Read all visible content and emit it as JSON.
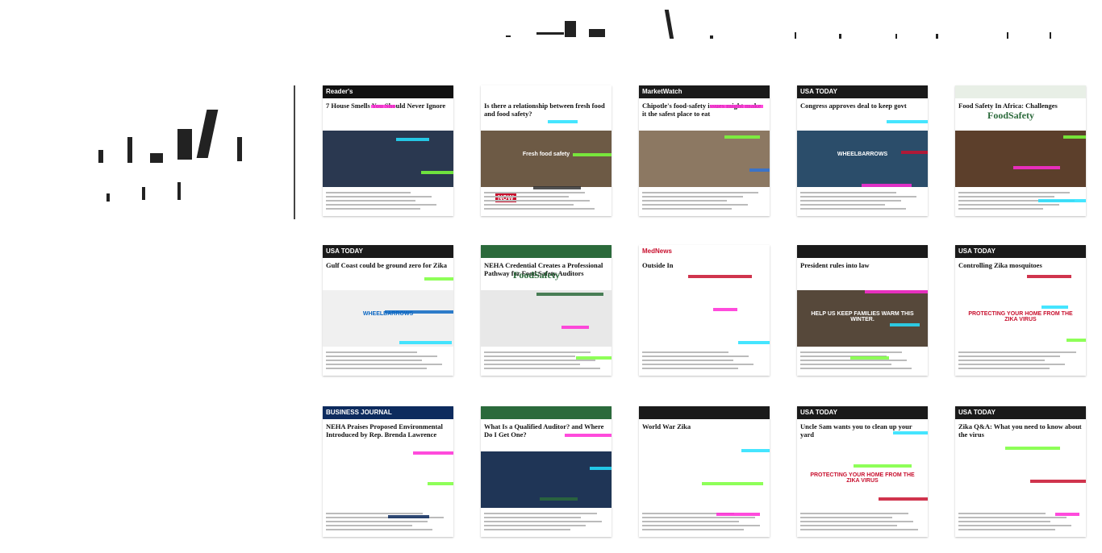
{
  "tiles": [
    {
      "id": "readers-digest",
      "logo": "Reader's",
      "title": "7 House Smells You Should Never Ignore",
      "bar": "#111",
      "accent": "#c8102e",
      "img": "#2a3850"
    },
    {
      "id": "food-safety-relationship",
      "logo": "",
      "title": "Is there a relationship between fresh food and food safety?",
      "bar": "#fff",
      "accent": "#333",
      "img": "#6d5a45",
      "caption": "Fresh food safety",
      "tag": "NOW"
    },
    {
      "id": "marketwatch",
      "logo": "MarketWatch",
      "title": "Chipotle's food-safety issues might make it the safest place to eat",
      "bar": "#1a1a1a",
      "accent": "#2d72d9",
      "img": "#8c7862"
    },
    {
      "id": "usatoday-zika-deal",
      "logo": "USA TODAY",
      "title": "Congress approves deal to keep govt",
      "bar": "#1a1a1a",
      "accent": "#c8102e",
      "img": "#2b4d6a",
      "caption": "WHEELBARROWS"
    },
    {
      "id": "food-safety-magazine-1",
      "logo": "",
      "title": "Food Safety In Africa: Challenges",
      "bar": "#e8efe6",
      "accent": "#2b6a3b",
      "img": "#5c3f2b",
      "brand": "FoodSafety"
    },
    {
      "id": "usatoday-gulf-coast",
      "logo": "USA TODAY",
      "title": "Gulf Coast could be ground zero for Zika",
      "bar": "#1a1a1a",
      "accent": "#0a66c2",
      "img": "#f0f0f0",
      "caption": "WHEELBARROWS"
    },
    {
      "id": "food-safety-magazine-2",
      "logo": "",
      "title": "NEHA Credential Creates a Professional Pathway for Food Safety Auditors",
      "bar": "#2b6a3b",
      "accent": "#2b6a3b",
      "img": "#e8e8e8",
      "brand": "FoodSafety"
    },
    {
      "id": "medical-news",
      "logo": "MedNews",
      "title": "Outside In",
      "bar": "#fff",
      "accent": "#c8102e",
      "img": "#ffffff"
    },
    {
      "id": "breaking-news",
      "logo": "",
      "title": "President rules into law",
      "bar": "#1a1a1a",
      "accent": "#c8102e",
      "img": "#56483a",
      "caption": "HELP US KEEP FAMILIES WARM THIS WINTER."
    },
    {
      "id": "usatoday-protect-home",
      "logo": "USA TODAY",
      "title": "Controlling Zika mosquitoes",
      "bar": "#1a1a1a",
      "accent": "#c8102e",
      "img": "#ffffff",
      "caption": "PROTECTING YOUR HOME FROM THE ZIKA VIRUS"
    },
    {
      "id": "business-journal",
      "logo": "BUSINESS JOURNAL",
      "title": "NEHA Praises Proposed Environmental Introduced by Rep. Brenda Lawrence",
      "bar": "#0d2b5e",
      "accent": "#0d2b5e",
      "img": "#ffffff"
    },
    {
      "id": "food-auditor",
      "logo": "",
      "title": "What Is a Qualified Auditor? and Where Do I Get One?",
      "bar": "#2b6a3b",
      "accent": "#2b6a3b",
      "img": "#1f3556"
    },
    {
      "id": "world-war-zika",
      "logo": "",
      "title": "World War Zika",
      "bar": "#1a1a1a",
      "accent": "#333",
      "img": "#ffffff"
    },
    {
      "id": "usatoday-uncle-sam",
      "logo": "USA TODAY",
      "title": "Uncle Sam wants you to clean up your yard",
      "bar": "#1a1a1a",
      "accent": "#c8102e",
      "img": "#ffffff",
      "caption": "PROTECTING YOUR HOME FROM THE ZIKA VIRUS"
    },
    {
      "id": "usatoday-zika-qa",
      "logo": "USA TODAY",
      "title": "Zika Q&A: What you need to know about the virus",
      "bar": "#1a1a1a",
      "accent": "#c8102e",
      "img": "#ffffff"
    }
  ]
}
